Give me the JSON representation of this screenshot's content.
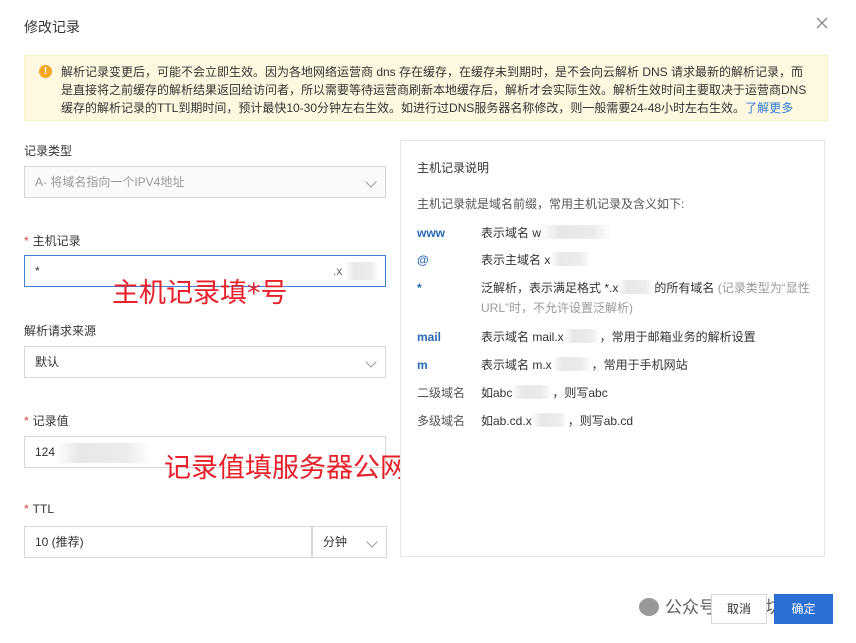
{
  "dialog": {
    "title": "修改记录"
  },
  "notice": {
    "text": "解析记录变更后，可能不会立即生效。因为各地网络运营商 dns 存在缓存，在缓存未到期时，是不会向云解析 DNS 请求最新的解析记录，而是直接将之前缓存的解析结果返回给访问者，所以需要等待运营商刷新本地缓存后，解析才会实际生效。解析生效时间主要取决于运营商DNS缓存的解析记录的TTL到期时间，预计最快10-30分钟左右生效。如进行过DNS服务器名称修改，则一般需要24-48小时左右生效。",
    "link": "了解更多"
  },
  "form": {
    "record_type": {
      "label": "记录类型",
      "value": "A- 将域名指向一个IPV4地址"
    },
    "host": {
      "required": "*",
      "label": "主机记录",
      "value": "*",
      "suffix": ".x"
    },
    "line": {
      "label": "解析请求来源",
      "value": "默认"
    },
    "record_value": {
      "required": "*",
      "label": "记录值",
      "value": "124"
    },
    "ttl": {
      "required": "*",
      "label": "TTL",
      "value": "10 (推荐)",
      "unit": "分钟"
    }
  },
  "annotations": {
    "host_note": "主机记录填*号",
    "value_note": "记录值填服务器公网IP"
  },
  "help": {
    "title": "主机记录说明",
    "intro": "主机记录就是域名前缀，常用主机记录及含义如下:",
    "rows": [
      {
        "key": "www",
        "text": "表示域名 w"
      },
      {
        "key": "@",
        "text": "表示主域名 x"
      },
      {
        "key": "*",
        "text": "泛解析，表示满足格式 *.x",
        "text2": "的所有域名",
        "muted": "(记录类型为“显性URL”时，不允许设置泛解析)"
      },
      {
        "key": "mail",
        "text": "表示域名 mail.x",
        "text2": "，常用于邮箱业务的解析设置"
      },
      {
        "key": "m",
        "text": "表示域名 m.x",
        "text2": "，常用于手机网站"
      },
      {
        "key": "二级域名",
        "text": "如abc",
        "text2": "，则写abc"
      },
      {
        "key": "多级域名",
        "text": "如ab.cd.x",
        "text2": "，则写ab.cd"
      }
    ]
  },
  "footer": {
    "cancel": "取消",
    "ok": "确定",
    "watermark": "公众号 · 知新坊"
  },
  "colors": {
    "primary": "#2b6fd4",
    "link": "#2a7bd6",
    "required": "#e04040",
    "annotation": "#e8202a",
    "notice_bg": "#fff8e1"
  }
}
